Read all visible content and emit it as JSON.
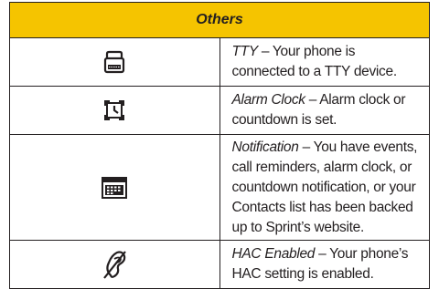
{
  "header": {
    "title": "Others"
  },
  "rows": [
    {
      "icon": "tty-icon",
      "term": "TTY",
      "text": " – Your phone is connected to a TTY device."
    },
    {
      "icon": "alarm-clock-icon",
      "term": "Alarm Clock",
      "text": " – Alarm clock or countdown is set."
    },
    {
      "icon": "notification-icon",
      "term": "Notification",
      "text": " – You have events, call reminders, alarm clock, or countdown notification, or your Contacts list has been backed up to Sprint’s website."
    },
    {
      "icon": "hac-enabled-icon",
      "term": "HAC Enabled",
      "text": " – Your phone’s HAC setting is enabled."
    }
  ],
  "colors": {
    "header_bg": "#f5c400",
    "border": "#231f20"
  }
}
